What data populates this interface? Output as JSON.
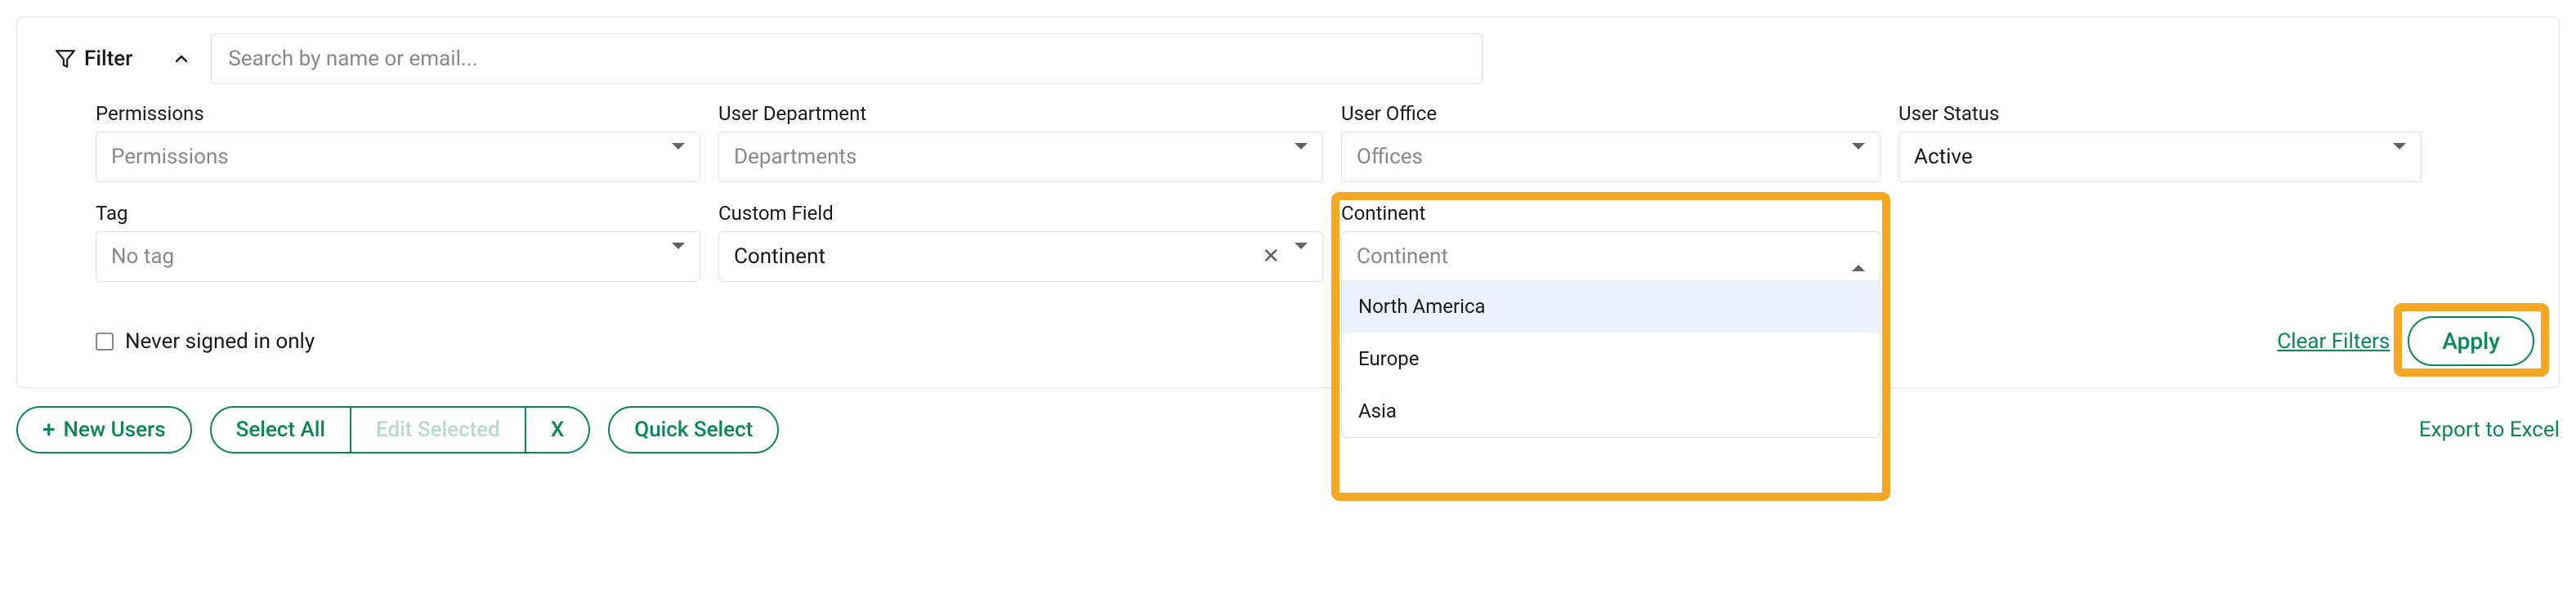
{
  "filterPanel": {
    "toggleLabel": "Filter",
    "searchPlaceholder": "Search by name or email..."
  },
  "filters": {
    "permissions": {
      "label": "Permissions",
      "placeholder": "Permissions"
    },
    "department": {
      "label": "User Department",
      "placeholder": "Departments"
    },
    "office": {
      "label": "User Office",
      "placeholder": "Offices"
    },
    "status": {
      "label": "User Status",
      "value": "Active"
    },
    "tag": {
      "label": "Tag",
      "placeholder": "No tag"
    },
    "customField": {
      "label": "Custom Field",
      "value": "Continent"
    },
    "continent": {
      "label": "Continent",
      "placeholder": "Continent",
      "options": [
        "North America",
        "Europe",
        "Asia"
      ]
    }
  },
  "neverSignedInLabel": "Never signed in only",
  "clearFiltersLabel": "Clear Filters",
  "applyLabel": "Apply",
  "toolbar": {
    "newUsers": "New Users",
    "selectAll": "Select All",
    "editSelected": "Edit Selected",
    "clearX": "X",
    "quickSelect": "Quick Select",
    "exportExcel": "Export to Excel"
  }
}
